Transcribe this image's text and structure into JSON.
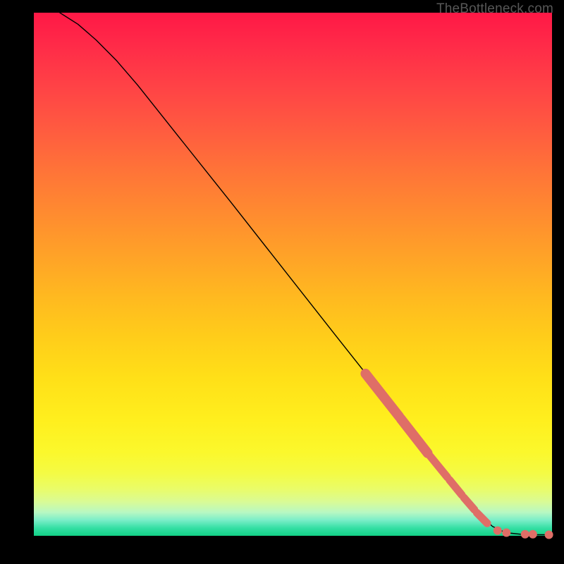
{
  "watermark": "TheBottleneck.com",
  "chart_data": {
    "type": "line",
    "title": "",
    "xlabel": "",
    "ylabel": "",
    "xlim": [
      0,
      100
    ],
    "ylim": [
      0,
      100
    ],
    "grid": false,
    "curve": [
      {
        "x": 5.0,
        "y": 100.0
      },
      {
        "x": 8.5,
        "y": 97.8
      },
      {
        "x": 12.0,
        "y": 94.8
      },
      {
        "x": 16.0,
        "y": 90.8
      },
      {
        "x": 20.0,
        "y": 86.2
      },
      {
        "x": 29.0,
        "y": 75.0
      },
      {
        "x": 38.0,
        "y": 63.8
      },
      {
        "x": 48.0,
        "y": 51.2
      },
      {
        "x": 58.0,
        "y": 38.6
      },
      {
        "x": 66.0,
        "y": 28.6
      },
      {
        "x": 74.0,
        "y": 18.6
      },
      {
        "x": 80.0,
        "y": 11.0
      },
      {
        "x": 85.0,
        "y": 5.0
      },
      {
        "x": 88.5,
        "y": 1.8
      },
      {
        "x": 91.0,
        "y": 0.6
      },
      {
        "x": 94.0,
        "y": 0.3
      },
      {
        "x": 97.0,
        "y": 0.2
      },
      {
        "x": 100.0,
        "y": 0.2
      }
    ],
    "highlight_segments": [
      {
        "x1": 64.0,
        "y1": 31.0,
        "x2": 70.5,
        "y2": 22.8,
        "w": 14
      },
      {
        "x1": 70.8,
        "y1": 22.4,
        "x2": 76.0,
        "y2": 15.8,
        "w": 14
      },
      {
        "x1": 76.5,
        "y1": 15.2,
        "x2": 79.8,
        "y2": 11.2,
        "w": 11
      },
      {
        "x1": 80.2,
        "y1": 10.7,
        "x2": 82.6,
        "y2": 7.8,
        "w": 11
      },
      {
        "x1": 83.0,
        "y1": 7.3,
        "x2": 85.0,
        "y2": 5.0,
        "w": 11
      },
      {
        "x1": 85.5,
        "y1": 4.4,
        "x2": 87.5,
        "y2": 2.4,
        "w": 11
      }
    ],
    "highlight_dots": [
      {
        "x": 89.5,
        "y": 1.0,
        "r": 6
      },
      {
        "x": 91.2,
        "y": 0.6,
        "r": 6
      },
      {
        "x": 94.8,
        "y": 0.3,
        "r": 6
      },
      {
        "x": 96.3,
        "y": 0.3,
        "r": 6
      },
      {
        "x": 99.4,
        "y": 0.2,
        "r": 6
      }
    ],
    "colors": {
      "gradient_top": "#ff1846",
      "gradient_bottom": "#12d186",
      "curve": "#000000",
      "highlight": "#df6e67",
      "background": "#000000"
    }
  }
}
